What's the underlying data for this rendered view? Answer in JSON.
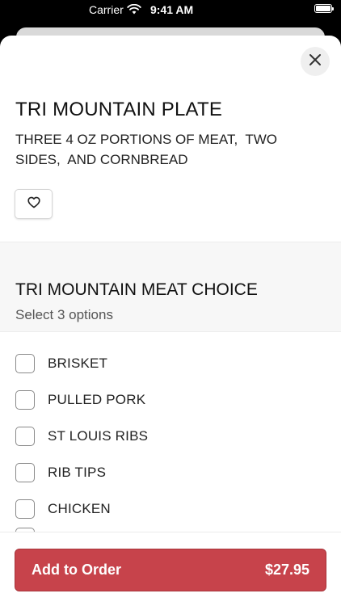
{
  "status_bar": {
    "carrier": "Carrier",
    "time": "9:41 AM"
  },
  "item": {
    "title": "TRI MOUNTAIN PLATE",
    "description": "THREE 4 OZ PORTIONS OF MEAT,  TWO SIDES,  AND CORNBREAD"
  },
  "modifier_group": {
    "title": "TRI MOUNTAIN MEAT CHOICE",
    "subtitle": "Select 3 options",
    "options": [
      {
        "label": "BRISKET",
        "checked": false
      },
      {
        "label": "PULLED PORK",
        "checked": false
      },
      {
        "label": "ST LOUIS RIBS",
        "checked": false
      },
      {
        "label": "RIB TIPS",
        "checked": false
      },
      {
        "label": "CHICKEN",
        "checked": false
      }
    ]
  },
  "footer": {
    "add_label": "Add to Order",
    "price": "$27.95"
  },
  "colors": {
    "accent": "#c7434b",
    "sheet_background": "#ffffff",
    "section_background": "#f7f7f7"
  },
  "icons": {
    "close": "close-icon",
    "favorite": "heart-icon"
  }
}
